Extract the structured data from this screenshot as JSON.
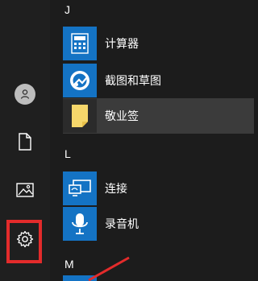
{
  "groups": {
    "j": "J",
    "l": "L",
    "m": "M"
  },
  "apps": [
    {
      "label": "计算器",
      "icon": "calculator-icon"
    },
    {
      "label": "截图和草图",
      "icon": "snip-sketch-icon"
    },
    {
      "label": "敬业签",
      "icon": "sticky-note-icon"
    },
    {
      "label": "连接",
      "icon": "connect-icon"
    },
    {
      "label": "录音机",
      "icon": "voice-recorder-icon"
    }
  ],
  "rail": {
    "icons": [
      "user-icon",
      "document-icon",
      "pictures-icon",
      "gear-icon"
    ]
  },
  "colors": {
    "tile": "#1473c4",
    "highlight": "#e32b2b",
    "selected_row": "#3b3b3b"
  }
}
